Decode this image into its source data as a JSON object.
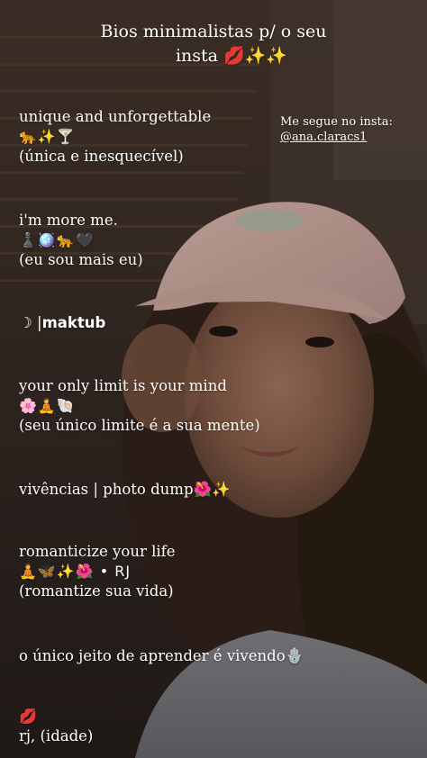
{
  "header": {
    "title_line1": "Bios minimalistas p/ o seu",
    "title_line2": "insta 💋✨✨"
  },
  "promo": {
    "label": "Me segue no insta:",
    "handle": "@ana.claracs1"
  },
  "bios": [
    {
      "line1": "unique and unforgettable",
      "line2": "🐆✨🍸",
      "line3": "(única e inesquecível)"
    },
    {
      "line1": "i'm more me.",
      "line2": "♟️🪩🐆🖤",
      "line3": "(eu sou mais eu)"
    },
    {
      "symbol": "☽ |",
      "bold_text": "maktub"
    },
    {
      "line1": "your only limit is your mind",
      "line2": "🌸🧘🐚",
      "line3": "(seu único limite é a sua mente)"
    },
    {
      "line1": "vivências | photo dump🌺✨"
    },
    {
      "line1": "romanticize your life",
      "line2": "🧘🦋✨🌺 • RJ",
      "line3": "(romantize sua vida)"
    },
    {
      "line1": "o único jeito de aprender é vivendo🪬"
    },
    {
      "line1": "💋",
      "line2": "rj, (idade)"
    }
  ]
}
